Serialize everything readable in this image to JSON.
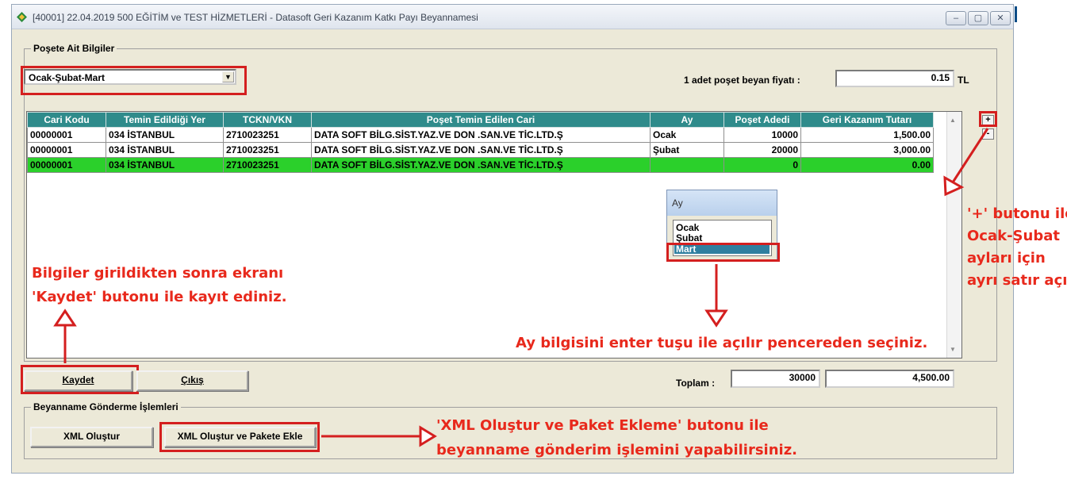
{
  "window": {
    "title": "[40001] 22.04.2019  500  EĞİTİM ve TEST HİZMETLERİ  -  Datasoft Geri Kazanım Katkı Payı Beyannamesi",
    "min": "–",
    "max": "▢",
    "close": "✕"
  },
  "poset_group": {
    "legend": "Poşete Ait Bilgiler",
    "period_selected": "Ocak-Şubat-Mart",
    "price_label": "1 adet poşet beyan fiyatı :",
    "price_value": "0.15",
    "price_unit": "TL"
  },
  "table": {
    "headers": [
      "Cari Kodu",
      "Temin Edildiği Yer",
      "TCKN/VKN",
      "Poşet Temin Edilen Cari",
      "Ay",
      "Poşet Adedi",
      "Geri Kazanım Tutarı"
    ],
    "rows": [
      [
        "00000001",
        "034 İSTANBUL",
        "2710023251",
        "DATA SOFT BİLG.SİST.YAZ.VE DON .SAN.VE TİC.LTD.Ş",
        "Ocak",
        "10000",
        "1,500.00"
      ],
      [
        "00000001",
        "034 İSTANBUL",
        "2710023251",
        "DATA SOFT BİLG.SİST.YAZ.VE DON .SAN.VE TİC.LTD.Ş",
        "Şubat",
        "20000",
        "3,000.00"
      ],
      [
        "00000001",
        "034 İSTANBUL",
        "2710023251",
        "DATA SOFT BİLG.SİST.YAZ.VE DON .SAN.VE TİC.LTD.Ş",
        "",
        "0",
        "0.00"
      ]
    ],
    "plus": "+",
    "minus": "-"
  },
  "month_popup": {
    "title": "Ay",
    "options": [
      "Ocak",
      "Şubat",
      "Mart"
    ],
    "selected": "Mart"
  },
  "buttons": {
    "save": "Kaydet",
    "exit": "Çıkış",
    "xml_create": "XML Oluştur",
    "xml_create_package": "XML Oluştur ve Pakete Ekle"
  },
  "totals": {
    "label": "Toplam :",
    "count": "30000",
    "amount": "4,500.00"
  },
  "send_group": {
    "legend": "Beyanname Gönderme İşlemleri"
  },
  "annotations": {
    "plus_note": [
      "'+' butonu ile",
      "Ocak-Şubat",
      "ayları için",
      "ayrı satır açınız."
    ],
    "save_note": [
      "Bilgiler girildikten sonra ekranı",
      "'Kaydet' butonu ile kayıt ediniz."
    ],
    "month_note": "Ay bilgisini enter tuşu ile açılır pencereden seçiniz.",
    "xml_note": [
      "'XML Oluştur ve Paket Ekleme' butonu ile",
      "beyanname gönderim işlemini yapabilirsiniz."
    ]
  },
  "colors": {
    "header_teal": "#2f8b8b",
    "selected_row_green": "#2bd02b",
    "annotation_red": "#e8291c"
  }
}
